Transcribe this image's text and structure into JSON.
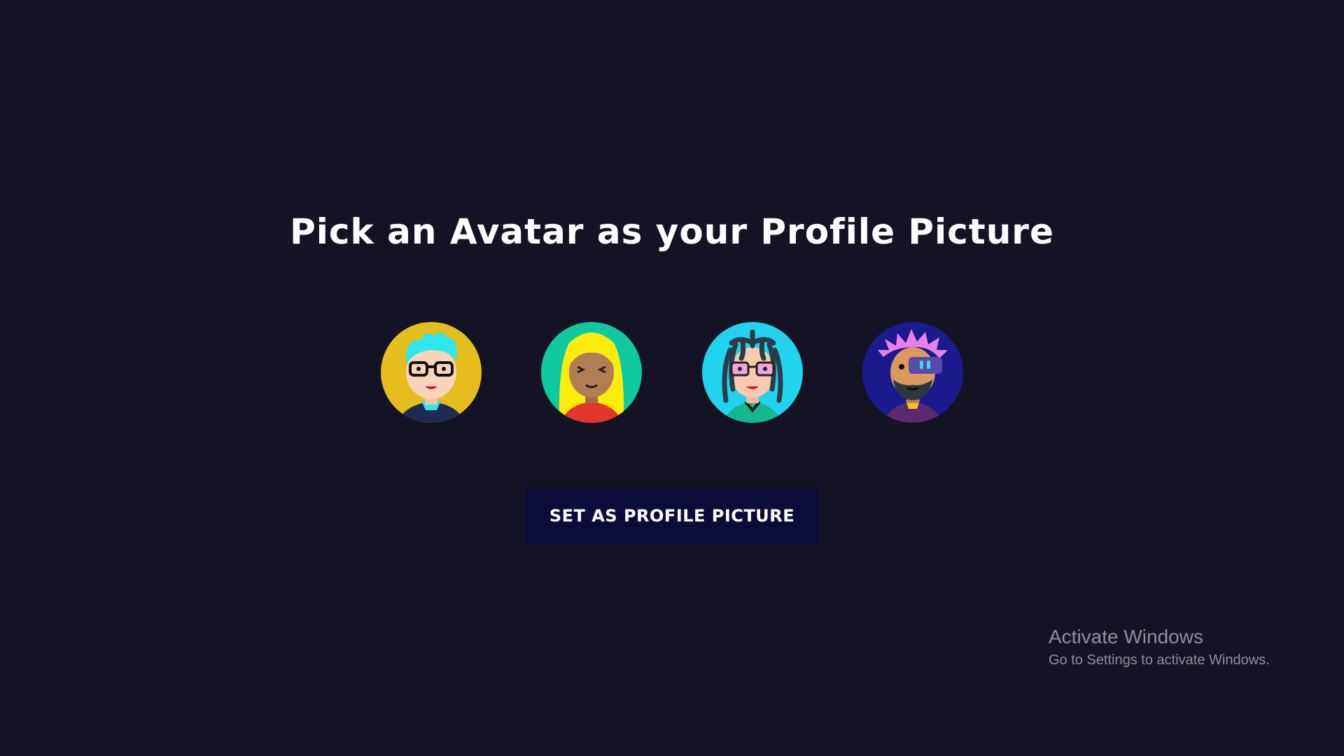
{
  "page": {
    "title": "Pick an Avatar as your Profile Picture"
  },
  "avatars": [
    {
      "id": "avatar-1",
      "bg": "#e5bd1c",
      "hair": "#2ee6f0",
      "skin": "#f9d4b8"
    },
    {
      "id": "avatar-2",
      "bg": "#0fc9a3",
      "hair": "#fcec0a",
      "skin": "#b07d55"
    },
    {
      "id": "avatar-3",
      "bg": "#22d3ee",
      "hair": "#2a3b4a",
      "skin": "#f9c9b0"
    },
    {
      "id": "avatar-4",
      "bg": "#1b1a8c",
      "hair": "#e97fe8",
      "skin": "#d99a5b"
    }
  ],
  "actions": {
    "set_profile_label": "SET AS PROFILE PICTURE"
  },
  "windows_watermark": {
    "title": "Activate Windows",
    "subtitle": "Go to Settings to activate Windows."
  },
  "colors": {
    "background": "#131324",
    "button_bg": "#0c0c3b",
    "text": "#ffffff"
  }
}
